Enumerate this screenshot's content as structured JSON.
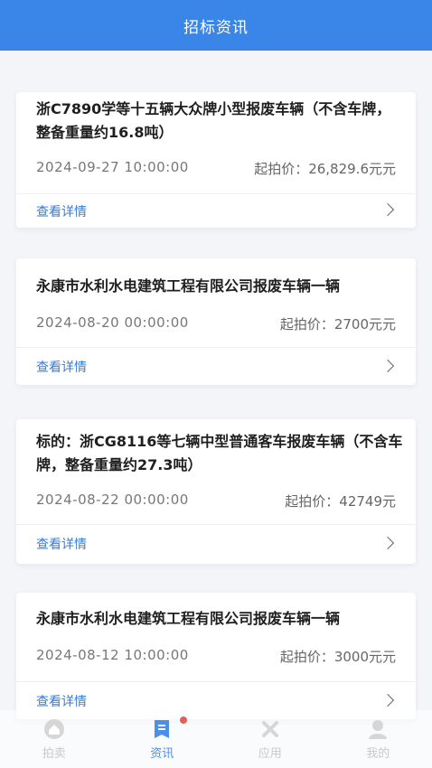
{
  "header": {
    "title": "招标资讯"
  },
  "listings": [
    {
      "title": "浙C7890学等十五辆大众牌小型报废车辆（不含车牌，整备重量约16.8吨）",
      "date": "2024-09-27 10:00:00",
      "price": "起拍价：26,829.6元元",
      "link": "查看详情"
    },
    {
      "title": "永康市水利水电建筑工程有限公司报废车辆一辆",
      "date": "2024-08-20 00:00:00",
      "price": "起拍价：2700元元",
      "link": "查看详情"
    },
    {
      "title": "标的：浙CG8116等七辆中型普通客车报废车辆（不含车牌，整备重量约27.3吨）",
      "date": "2024-08-22 00:00:00",
      "price": "起拍价：42749元",
      "link": "查看详情"
    },
    {
      "title": "永康市水利水电建筑工程有限公司报废车辆一辆",
      "date": "2024-08-12 10:00:00",
      "price": "起拍价：3000元元",
      "link": "查看详情"
    }
  ],
  "tabbar": {
    "tabs": [
      {
        "label": "拍卖",
        "icon": "home-icon",
        "active": false
      },
      {
        "label": "资讯",
        "icon": "news-icon",
        "active": true
      },
      {
        "label": "应用",
        "icon": "apps-icon",
        "active": false
      },
      {
        "label": "我的",
        "icon": "user-icon",
        "active": false
      }
    ]
  },
  "colors": {
    "accent": "#3a86e8",
    "link": "#2f7de1",
    "badge": "#e85b5b"
  }
}
